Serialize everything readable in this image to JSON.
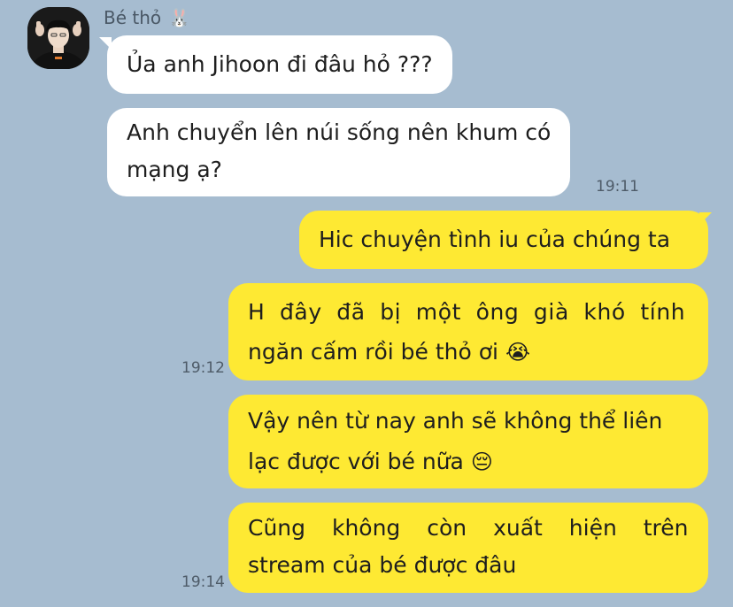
{
  "contact": {
    "name": "Bé thỏ",
    "name_emoji": "🐰",
    "avatar_icon": "profile-photo-icon"
  },
  "messages": [
    {
      "direction": "incoming",
      "lines": [
        "Ủa anh Jihoon đi đâu hỏ ???"
      ],
      "time": ""
    },
    {
      "direction": "incoming",
      "lines": [
        "Anh chuyển lên núi sống nên khum có",
        "mạng ạ?"
      ],
      "time": "19:11"
    },
    {
      "direction": "outgoing",
      "lines": [
        "Hic chuyện tình iu của chúng ta"
      ],
      "time": ""
    },
    {
      "direction": "outgoing",
      "lines": [
        "H đây đã bị một ông già khó tính",
        "ngăn cấm rồi bé thỏ ơi"
      ],
      "emoji": "😭",
      "time": "19:12"
    },
    {
      "direction": "outgoing",
      "lines": [
        "Vậy nên từ nay anh sẽ không thể liên",
        "lạc được với bé nữa"
      ],
      "emoji": "😔",
      "time": ""
    },
    {
      "direction": "outgoing",
      "lines": [
        "Cũng không còn xuất hiện trên",
        "stream của bé được đâu"
      ],
      "time": "19:14"
    }
  ],
  "colors": {
    "background": "#a6bcd0",
    "incoming_bubble": "#ffffff",
    "outgoing_bubble": "#fee933"
  }
}
